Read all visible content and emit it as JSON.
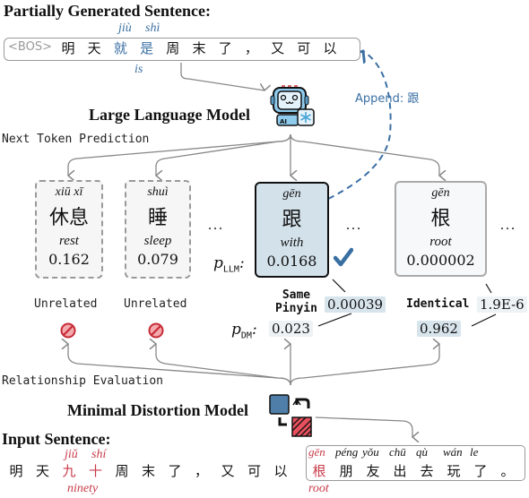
{
  "partial": {
    "title": "Partially Generated Sentence:",
    "bos": "<BOS>",
    "tokens": [
      "明",
      "天",
      "就",
      "是",
      "周",
      "末",
      "了",
      "，",
      "又",
      "可",
      "以"
    ],
    "highlight_pinyin": [
      "jiù",
      "shì"
    ],
    "highlight_gloss": "is",
    "append_label": "Append: 跟"
  },
  "llm": {
    "title": "Large Language Model",
    "stage_label": "Next Token Prediction",
    "icon": "robot-icon"
  },
  "candidates": [
    {
      "pinyin": "xiū xī",
      "hanzi": "休息",
      "gloss": "rest",
      "p_llm": "0.162",
      "relation": "Unrelated",
      "style": "dashed"
    },
    {
      "pinyin": "shuì",
      "hanzi": "睡",
      "gloss": "sleep",
      "p_llm": "0.079",
      "relation": "Unrelated",
      "style": "dashed"
    },
    {
      "pinyin": "gēn",
      "hanzi": "跟",
      "gloss": "with",
      "p_llm": "0.0168",
      "relation": "Same Pinyin",
      "relation_line2": "Pinyin",
      "p_dm": "0.023",
      "product": "0.00039",
      "style": "chosen"
    },
    {
      "pinyin": "gēn",
      "hanzi": "根",
      "gloss": "root",
      "p_llm": "0.000002",
      "relation": "Identical",
      "p_dm": "0.962",
      "product": "1.9E-6",
      "style": "plain"
    }
  ],
  "labels": {
    "p_llm": "p",
    "p_llm_sub": "LLM",
    "p_dm": "p",
    "p_dm_sub": "DM",
    "ellipsis": "...",
    "same": "Same",
    "pinyin": "Pinyin"
  },
  "dm": {
    "stage_label": "Relationship Evaluation",
    "title": "Minimal Distortion Model"
  },
  "input": {
    "title": "Input Sentence:",
    "tokens": [
      "明",
      "天",
      "九",
      "十",
      "周",
      "末",
      "了",
      "，",
      "又",
      "可",
      "以"
    ],
    "error_pinyin": [
      "jiǔ",
      "shí"
    ],
    "error_gloss": "ninety",
    "rest_tokens": [
      "根",
      "朋",
      "友",
      "出",
      "去",
      "玩",
      "了",
      "。"
    ],
    "rest_pinyin": [
      "gēn",
      "péng",
      "yǒu",
      "chū",
      "qù",
      "wán",
      "le",
      ""
    ],
    "rest_gloss": "root"
  },
  "colors": {
    "accent_blue": "#3a6fa3",
    "error_red": "#c83a48",
    "chosen_fill": "#d3e1ea"
  }
}
